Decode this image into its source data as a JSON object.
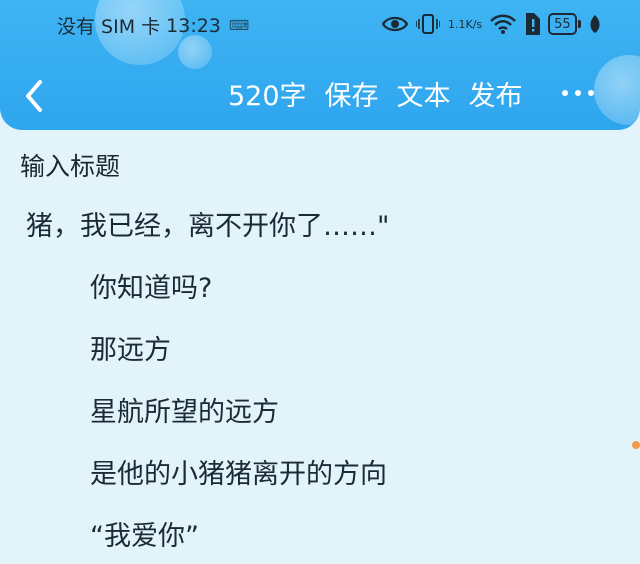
{
  "status_bar": {
    "carrier": "没有 SIM 卡",
    "time": "13:23",
    "net_speed_value": "1.1",
    "net_speed_unit": "K/s",
    "battery": "55"
  },
  "toolbar": {
    "word_count": "520字",
    "save_label": "保存",
    "text_label": "文本",
    "publish_label": "发布"
  },
  "title": {
    "placeholder": "输入标题"
  },
  "content": {
    "lines": [
      "猪，我已经，离不开你了……\"",
      "你知道吗?",
      "那远方",
      "星航所望的远方",
      "是他的小猪猪离开的方向",
      "“我爱你”"
    ]
  }
}
